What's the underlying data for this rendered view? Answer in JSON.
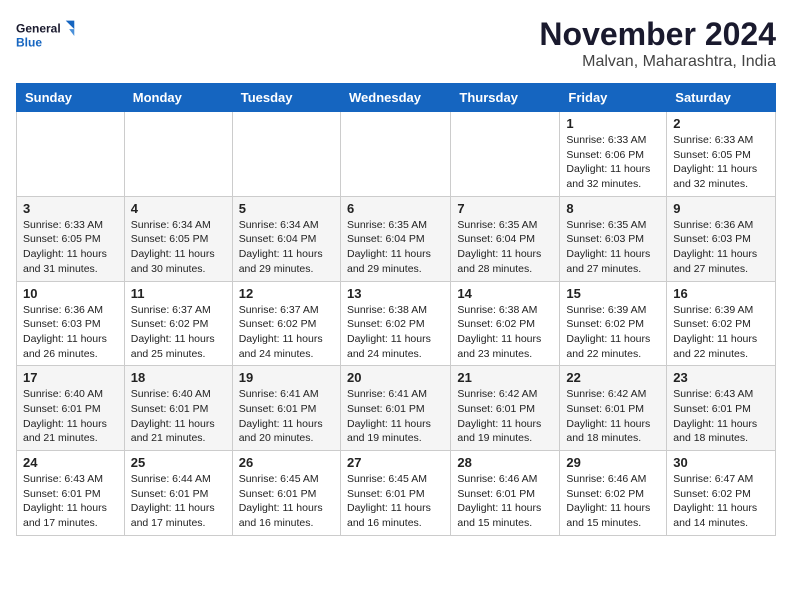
{
  "header": {
    "logo_line1": "General",
    "logo_line2": "Blue",
    "month_title": "November 2024",
    "location": "Malvan, Maharashtra, India"
  },
  "weekdays": [
    "Sunday",
    "Monday",
    "Tuesday",
    "Wednesday",
    "Thursday",
    "Friday",
    "Saturday"
  ],
  "weeks": [
    [
      {
        "day": "",
        "info": ""
      },
      {
        "day": "",
        "info": ""
      },
      {
        "day": "",
        "info": ""
      },
      {
        "day": "",
        "info": ""
      },
      {
        "day": "",
        "info": ""
      },
      {
        "day": "1",
        "info": "Sunrise: 6:33 AM\nSunset: 6:06 PM\nDaylight: 11 hours and 32 minutes."
      },
      {
        "day": "2",
        "info": "Sunrise: 6:33 AM\nSunset: 6:05 PM\nDaylight: 11 hours and 32 minutes."
      }
    ],
    [
      {
        "day": "3",
        "info": "Sunrise: 6:33 AM\nSunset: 6:05 PM\nDaylight: 11 hours and 31 minutes."
      },
      {
        "day": "4",
        "info": "Sunrise: 6:34 AM\nSunset: 6:05 PM\nDaylight: 11 hours and 30 minutes."
      },
      {
        "day": "5",
        "info": "Sunrise: 6:34 AM\nSunset: 6:04 PM\nDaylight: 11 hours and 29 minutes."
      },
      {
        "day": "6",
        "info": "Sunrise: 6:35 AM\nSunset: 6:04 PM\nDaylight: 11 hours and 29 minutes."
      },
      {
        "day": "7",
        "info": "Sunrise: 6:35 AM\nSunset: 6:04 PM\nDaylight: 11 hours and 28 minutes."
      },
      {
        "day": "8",
        "info": "Sunrise: 6:35 AM\nSunset: 6:03 PM\nDaylight: 11 hours and 27 minutes."
      },
      {
        "day": "9",
        "info": "Sunrise: 6:36 AM\nSunset: 6:03 PM\nDaylight: 11 hours and 27 minutes."
      }
    ],
    [
      {
        "day": "10",
        "info": "Sunrise: 6:36 AM\nSunset: 6:03 PM\nDaylight: 11 hours and 26 minutes."
      },
      {
        "day": "11",
        "info": "Sunrise: 6:37 AM\nSunset: 6:02 PM\nDaylight: 11 hours and 25 minutes."
      },
      {
        "day": "12",
        "info": "Sunrise: 6:37 AM\nSunset: 6:02 PM\nDaylight: 11 hours and 24 minutes."
      },
      {
        "day": "13",
        "info": "Sunrise: 6:38 AM\nSunset: 6:02 PM\nDaylight: 11 hours and 24 minutes."
      },
      {
        "day": "14",
        "info": "Sunrise: 6:38 AM\nSunset: 6:02 PM\nDaylight: 11 hours and 23 minutes."
      },
      {
        "day": "15",
        "info": "Sunrise: 6:39 AM\nSunset: 6:02 PM\nDaylight: 11 hours and 22 minutes."
      },
      {
        "day": "16",
        "info": "Sunrise: 6:39 AM\nSunset: 6:02 PM\nDaylight: 11 hours and 22 minutes."
      }
    ],
    [
      {
        "day": "17",
        "info": "Sunrise: 6:40 AM\nSunset: 6:01 PM\nDaylight: 11 hours and 21 minutes."
      },
      {
        "day": "18",
        "info": "Sunrise: 6:40 AM\nSunset: 6:01 PM\nDaylight: 11 hours and 21 minutes."
      },
      {
        "day": "19",
        "info": "Sunrise: 6:41 AM\nSunset: 6:01 PM\nDaylight: 11 hours and 20 minutes."
      },
      {
        "day": "20",
        "info": "Sunrise: 6:41 AM\nSunset: 6:01 PM\nDaylight: 11 hours and 19 minutes."
      },
      {
        "day": "21",
        "info": "Sunrise: 6:42 AM\nSunset: 6:01 PM\nDaylight: 11 hours and 19 minutes."
      },
      {
        "day": "22",
        "info": "Sunrise: 6:42 AM\nSunset: 6:01 PM\nDaylight: 11 hours and 18 minutes."
      },
      {
        "day": "23",
        "info": "Sunrise: 6:43 AM\nSunset: 6:01 PM\nDaylight: 11 hours and 18 minutes."
      }
    ],
    [
      {
        "day": "24",
        "info": "Sunrise: 6:43 AM\nSunset: 6:01 PM\nDaylight: 11 hours and 17 minutes."
      },
      {
        "day": "25",
        "info": "Sunrise: 6:44 AM\nSunset: 6:01 PM\nDaylight: 11 hours and 17 minutes."
      },
      {
        "day": "26",
        "info": "Sunrise: 6:45 AM\nSunset: 6:01 PM\nDaylight: 11 hours and 16 minutes."
      },
      {
        "day": "27",
        "info": "Sunrise: 6:45 AM\nSunset: 6:01 PM\nDaylight: 11 hours and 16 minutes."
      },
      {
        "day": "28",
        "info": "Sunrise: 6:46 AM\nSunset: 6:01 PM\nDaylight: 11 hours and 15 minutes."
      },
      {
        "day": "29",
        "info": "Sunrise: 6:46 AM\nSunset: 6:02 PM\nDaylight: 11 hours and 15 minutes."
      },
      {
        "day": "30",
        "info": "Sunrise: 6:47 AM\nSunset: 6:02 PM\nDaylight: 11 hours and 14 minutes."
      }
    ]
  ]
}
